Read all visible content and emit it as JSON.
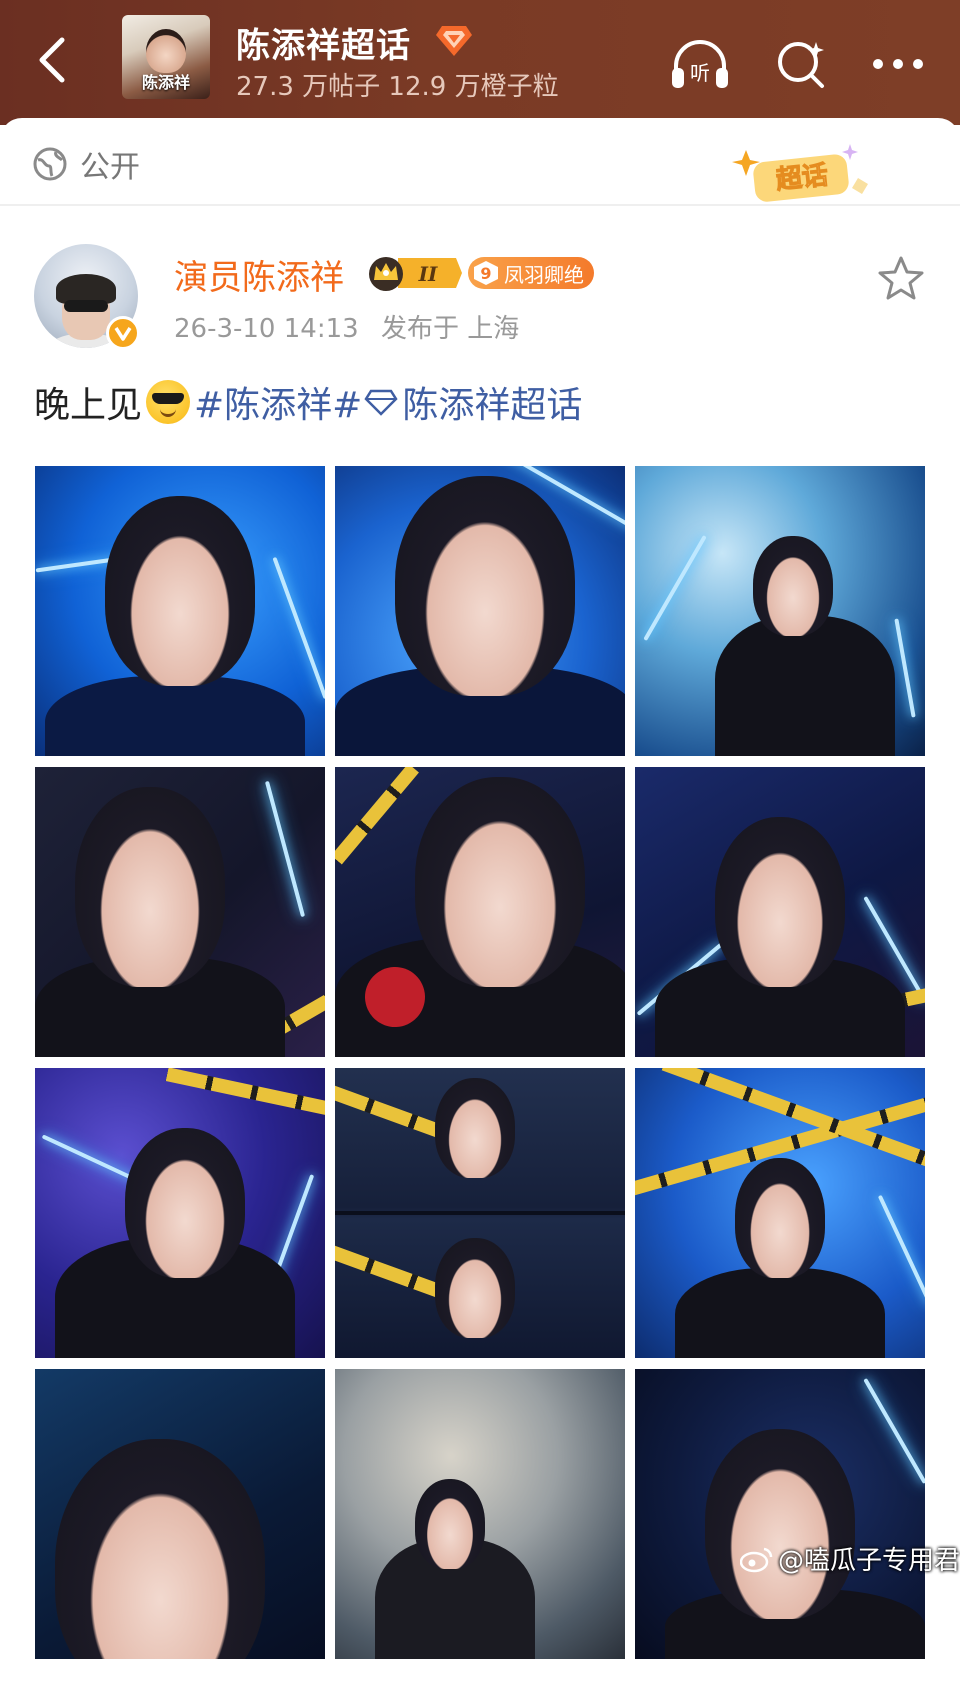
{
  "header": {
    "back_label": "back",
    "cover_text": "陈添祥",
    "topic_title": "陈添祥超话",
    "topic_stats": "27.3 万帖子 12.9 万橙子粒",
    "listen_label": "听"
  },
  "visibility": {
    "label": "公开"
  },
  "supertopic_badge": {
    "label": "超话"
  },
  "post": {
    "author": "演员陈添祥",
    "crown_level": "II",
    "fan_level": "9",
    "fan_badge_text": "凤羽卿绝",
    "timestamp": "26-3-10 14:13",
    "location": "发布于 上海",
    "text_prefix": "晚上见",
    "hashtag": "#陈添祥#",
    "topic_link": "陈添祥超话"
  },
  "photos": [
    {
      "scene": "blue-neon-closeup"
    },
    {
      "scene": "blue-closeup-tilt"
    },
    {
      "scene": "smoke-standing"
    },
    {
      "scene": "dark-portrait-left"
    },
    {
      "scene": "spinner-closeup"
    },
    {
      "scene": "dark-portrait-right"
    },
    {
      "scene": "neon-purple"
    },
    {
      "scene": "split-double"
    },
    {
      "scene": "caution-tape-standing"
    },
    {
      "scene": "dark-closeup-crop"
    },
    {
      "scene": "fog-seated"
    },
    {
      "scene": "dark-portrait-three-quarter"
    }
  ],
  "watermark": {
    "text": "@嗑瓜子专用君"
  },
  "colors": {
    "header_bg": "#7a3a25",
    "author_orange": "#f26a1b",
    "link_blue": "#3f5ea3",
    "verified_gold": "#f6a61c"
  },
  "icons": [
    "back-arrow-icon",
    "diamond-icon",
    "headphones-icon",
    "search-sparkle-icon",
    "more-icon",
    "globe-icon",
    "star-icon",
    "verified-v-icon",
    "crown-icon",
    "diamond-small-icon",
    "sunglasses-emoji-icon",
    "weibo-logo-icon"
  ]
}
